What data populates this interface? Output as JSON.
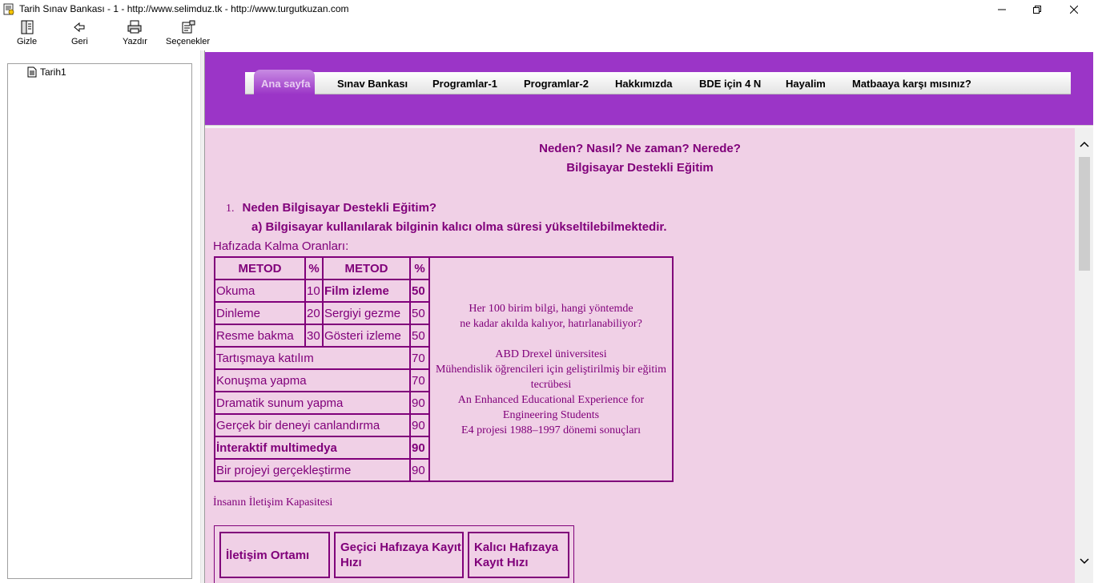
{
  "window": {
    "title": "Tarih Sınav Bankası - 1 - http://www.selimduz.tk -  http://www.turgutkuzan.com"
  },
  "toolbar": {
    "buttons": [
      {
        "label": "Gizle",
        "icon": "hide-icon"
      },
      {
        "label": "Geri",
        "icon": "back-arrow-icon"
      },
      {
        "label": "Yazdır",
        "icon": "printer-icon"
      },
      {
        "label": "Seçenekler",
        "icon": "options-icon"
      }
    ]
  },
  "tree": {
    "items": [
      {
        "label": "Tarih1"
      }
    ]
  },
  "nav": {
    "items": [
      "Ana sayfa",
      "Sınav Bankası",
      "Programlar-1",
      "Programlar-2",
      "Hakkımızda",
      "BDE için 4 N",
      "Hayalim",
      "Matbaaya karşı mısınız?"
    ]
  },
  "content": {
    "heading1": "Neden? Nasıl? Ne zaman? Nerede?",
    "heading2": "Bilgisayar Destekli Eğitim",
    "q1_num": "1.",
    "q1_text": "Neden Bilgisayar Destekli Eğitim?",
    "qa_text": "a)  Bilgisayar kullanılarak bilginin kalıcı olma süresi yükseltilebilmektedir.",
    "retention_label": "Hafızada Kalma Oranları:",
    "table": {
      "headers": [
        "METOD",
        "%",
        "METOD",
        "%"
      ],
      "paired_rows": [
        {
          "m1": "Okuma",
          "p1": "10",
          "m2": "Film izleme",
          "p2": "50"
        },
        {
          "m1": "Dinleme",
          "p1": "20",
          "m2": "Sergiyi gezme",
          "p2": "50"
        },
        {
          "m1": "Resme bakma",
          "p1": "30",
          "m2": "Gösteri izleme",
          "p2": "50"
        }
      ],
      "single_rows": [
        {
          "method": "Tartışmaya katılım",
          "pct": "70"
        },
        {
          "method": "Konuşma yapma",
          "pct": "70"
        },
        {
          "method": "Dramatik sunum yapma",
          "pct": "90"
        },
        {
          "method": "Gerçek bir deneyi canlandırma",
          "pct": "90"
        },
        {
          "method": "İnteraktif multimedya",
          "pct": "90"
        },
        {
          "method": "Bir projeyi gerçekleştirme",
          "pct": "90"
        }
      ],
      "note_lines": [
        "Her 100 birim bilgi, hangi yöntemde",
        "ne kadar akılda kalıyor, hatırlanabiliyor?",
        "",
        "ABD Drexel üniversitesi",
        "Mühendislik öğrencileri için geliştirilmiş bir eğitim tecrübesi",
        "An Enhanced Educational Experience for Engineering Students",
        "E4 projesi 1988–1997 dönemi sonuçları"
      ]
    },
    "capacity_label": "İnsanın İletişim Kapasitesi",
    "capacity_boxes": [
      "İletişim Ortamı",
      "Geçici Hafızaya Kayıt Hızı",
      "Kalıcı Hafızaya Kayıt Hızı"
    ]
  },
  "colors": {
    "header_purple": "#9b35c7",
    "content_bg": "#f0d0e6",
    "text_purple": "#80007a"
  }
}
